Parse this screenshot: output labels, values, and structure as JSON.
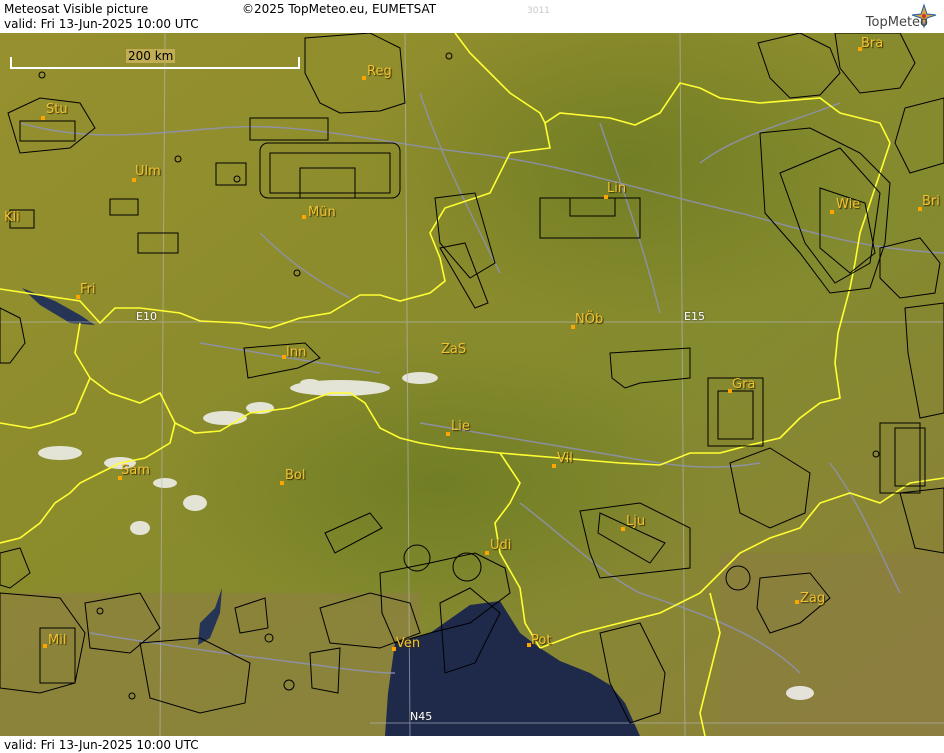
{
  "header": {
    "title": "Meteosat Visible picture",
    "valid": "valid:  Fri  13-Jun-2025  10:00 UTC",
    "copyright": "©2025 TopMeteo.eu, EUMETSAT",
    "code": "3011",
    "logo_text": "TopMeteo"
  },
  "footer": {
    "valid": "valid:  Fri  13-Jun-2025  10:00 UTC"
  },
  "scale_bar": {
    "label": "200 km"
  },
  "grid_labels": {
    "e10": "E10",
    "e15": "E15",
    "n45": "N45"
  },
  "cities": {
    "reg": "Reg",
    "bra": "Bra",
    "stu": "Stu",
    "ulm": "Ulm",
    "mun": "Mün",
    "lin": "Lin",
    "wie": "Wie",
    "bri": "Bri",
    "kli": "Kli",
    "fri": "Fri",
    "nob": "NÖb",
    "zas": "ZaS",
    "inn": "Inn",
    "gra": "Gra",
    "lie": "Lie",
    "vil": "Vil",
    "sam": "Sam",
    "bol": "Bol",
    "lju": "Lju",
    "udi": "Udi",
    "zag": "Zag",
    "mil": "Mil",
    "ven": "Ven",
    "pot": "Pot"
  },
  "colors": {
    "land": "#8a8a2a",
    "sea": "#1f2a4a",
    "border": "#ffff33",
    "airspace": "#000000",
    "city_label": "#f1c232",
    "rivers": "#8f93b8"
  }
}
